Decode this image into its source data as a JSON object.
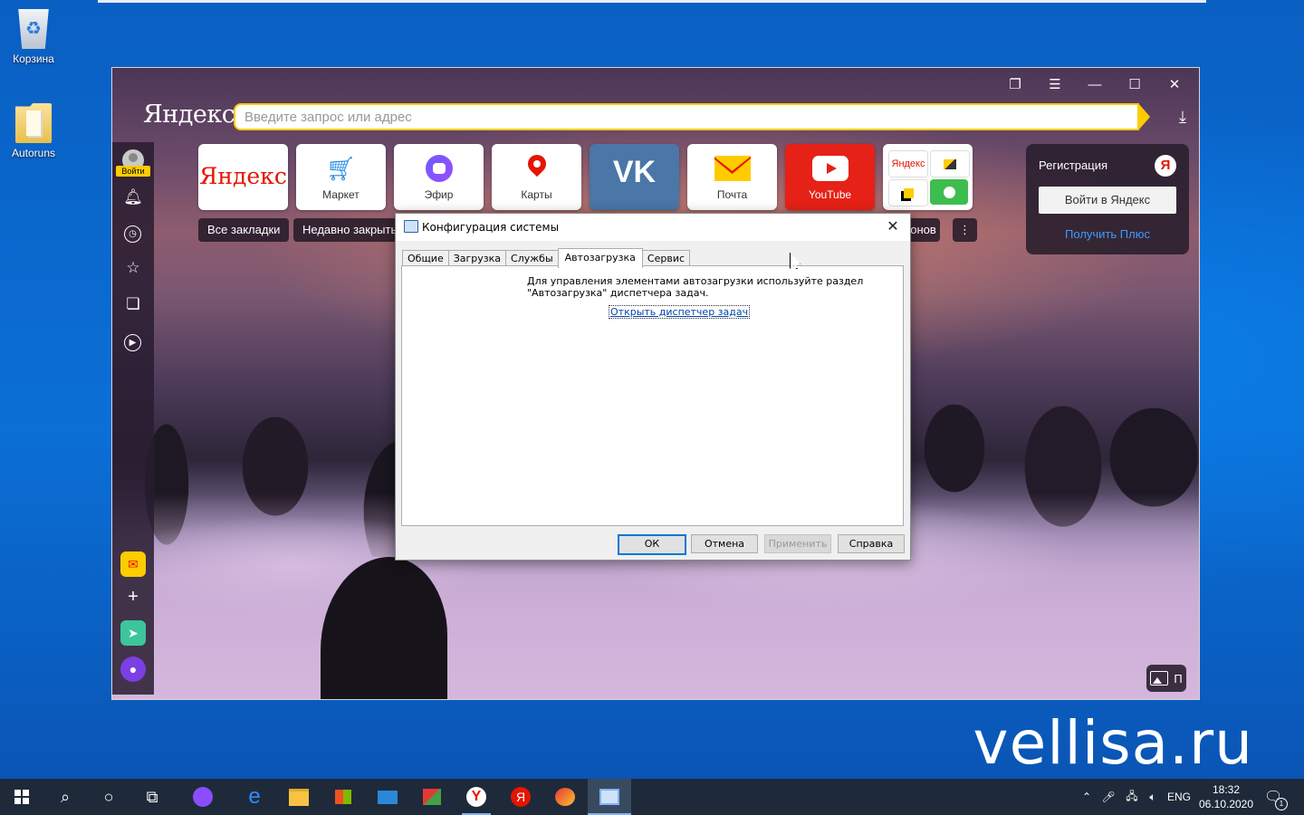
{
  "desktop": {
    "icons": [
      {
        "label": "Корзина",
        "icon": "recycle-bin-icon"
      },
      {
        "label": "Autoruns",
        "icon": "folder-icon"
      }
    ],
    "watermark": "vellisa.ru"
  },
  "browser": {
    "logo": "Яндекс",
    "search_placeholder": "Введите запрос или адрес",
    "side_panel": {
      "login_label": "Войти"
    },
    "tiles": [
      {
        "label": "",
        "glyph": "Яндекс"
      },
      {
        "label": "Маркет"
      },
      {
        "label": "Эфир"
      },
      {
        "label": "Карты"
      },
      {
        "label": ""
      },
      {
        "label": "Почта"
      },
      {
        "label": "YouTube"
      },
      {
        "mini_label": "Яндекс"
      }
    ],
    "pills": {
      "all_bookmarks": "Все закладки",
      "recently_closed": "Недавно закрыть",
      "partial": "ронов"
    },
    "registration": {
      "title": "Регистрация",
      "badge": "Я",
      "login_button": "Войти в Яндекс",
      "plus_link": "Получить Плюс"
    },
    "gallery_label": "П"
  },
  "dialog": {
    "title": "Конфигурация системы",
    "tabs": [
      "Общие",
      "Загрузка",
      "Службы",
      "Автозагрузка",
      "Сервис"
    ],
    "active_tab": "Автозагрузка",
    "message": "Для управления элементами автозагрузки используйте раздел \"Автозагрузка\" диспетчера задач.",
    "link": "Открыть диспетчер задач",
    "buttons": {
      "ok": "ОК",
      "cancel": "Отмена",
      "apply": "Применить",
      "help": "Справка"
    }
  },
  "taskbar": {
    "language": "ENG",
    "time": "18:32",
    "date": "06.10.2020",
    "notification_count": "1"
  }
}
